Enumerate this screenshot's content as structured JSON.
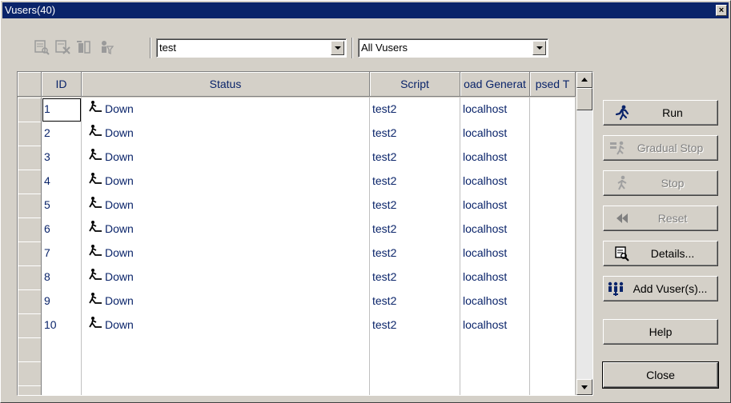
{
  "window": {
    "title": "Vusers(40)",
    "close_glyph": "×"
  },
  "toolbar": {
    "icons": [
      "group-details-icon",
      "remove-icon",
      "add-group-icon",
      "vuser-filter-icon"
    ],
    "group_combo": {
      "value": "test"
    },
    "filter_combo": {
      "value": "All Vusers"
    }
  },
  "grid": {
    "columns": [
      "ID",
      "Status",
      "Script",
      "oad Generat",
      "psed T"
    ],
    "rows": [
      {
        "id": "1",
        "status": "Down",
        "script": "test2",
        "generator": "localhost"
      },
      {
        "id": "2",
        "status": "Down",
        "script": "test2",
        "generator": "localhost"
      },
      {
        "id": "3",
        "status": "Down",
        "script": "test2",
        "generator": "localhost"
      },
      {
        "id": "4",
        "status": "Down",
        "script": "test2",
        "generator": "localhost"
      },
      {
        "id": "5",
        "status": "Down",
        "script": "test2",
        "generator": "localhost"
      },
      {
        "id": "6",
        "status": "Down",
        "script": "test2",
        "generator": "localhost"
      },
      {
        "id": "7",
        "status": "Down",
        "script": "test2",
        "generator": "localhost"
      },
      {
        "id": "8",
        "status": "Down",
        "script": "test2",
        "generator": "localhost"
      },
      {
        "id": "9",
        "status": "Down",
        "script": "test2",
        "generator": "localhost"
      },
      {
        "id": "10",
        "status": "Down",
        "script": "test2",
        "generator": "localhost"
      }
    ],
    "empty_rows": 3
  },
  "buttons": {
    "run": "Run",
    "gradual_stop": "Gradual Stop",
    "stop": "Stop",
    "reset": "Reset",
    "details": "Details...",
    "add_vusers": "Add Vuser(s)...",
    "help": "Help",
    "close": "Close"
  },
  "colors": {
    "titlebar": "#0a246a",
    "text_blue": "#0a246a",
    "face": "#d4d0c8"
  }
}
